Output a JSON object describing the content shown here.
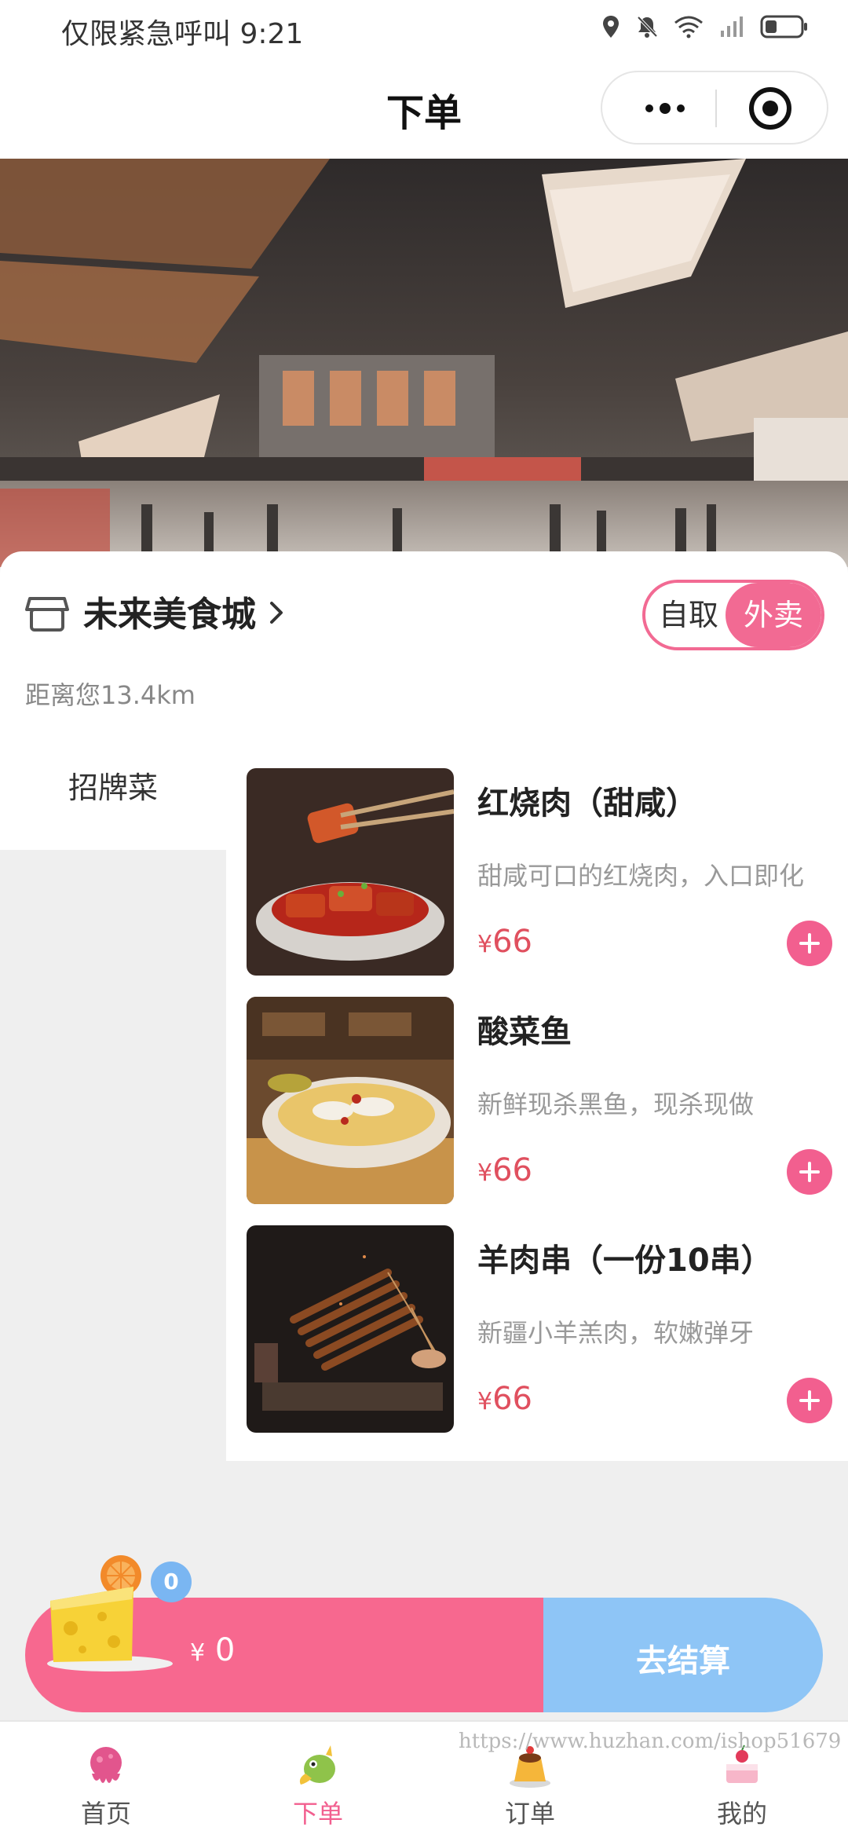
{
  "status_bar": {
    "left_text": "仅限紧急呼叫 9:21",
    "icons": [
      "location-icon",
      "bell-off-icon",
      "wifi-icon",
      "signal-icon",
      "battery-icon"
    ]
  },
  "nav": {
    "title": "下单",
    "capsule_icons": [
      "more-icon",
      "target-icon"
    ]
  },
  "store": {
    "name": "未来美食城",
    "distance": "距离您13.4km",
    "toggle": {
      "pickup": "自取",
      "delivery": "外卖",
      "selected": "外卖"
    }
  },
  "menu": {
    "categories": [
      {
        "label": "招牌菜",
        "selected": true
      }
    ],
    "items": [
      {
        "name": "红烧肉（甜咸）",
        "desc": "甜咸可口的红烧肉，入口即化",
        "currency": "¥",
        "price": "66"
      },
      {
        "name": "酸菜鱼",
        "desc": "新鲜现杀黑鱼，现杀现做",
        "currency": "¥",
        "price": "66"
      },
      {
        "name": "羊肉串（一份10串）",
        "desc": "新疆小羊羔肉，软嫩弹牙",
        "currency": "¥",
        "price": "66"
      }
    ]
  },
  "cart": {
    "count": "0",
    "currency": "¥",
    "total": "0",
    "checkout_label": "去结算"
  },
  "tabbar": {
    "tabs": [
      {
        "label": "首页",
        "icon": "octopus-icon"
      },
      {
        "label": "下单",
        "icon": "dragon-icon",
        "active": true
      },
      {
        "label": "订单",
        "icon": "pudding-icon"
      },
      {
        "label": "我的",
        "icon": "cake-icon"
      }
    ]
  },
  "watermark": "https://www.huzhan.com/ishop51679",
  "colors": {
    "accent_pink": "#f25f8f",
    "checkout_blue": "#8ec5f6",
    "price_red": "#e0505f"
  }
}
